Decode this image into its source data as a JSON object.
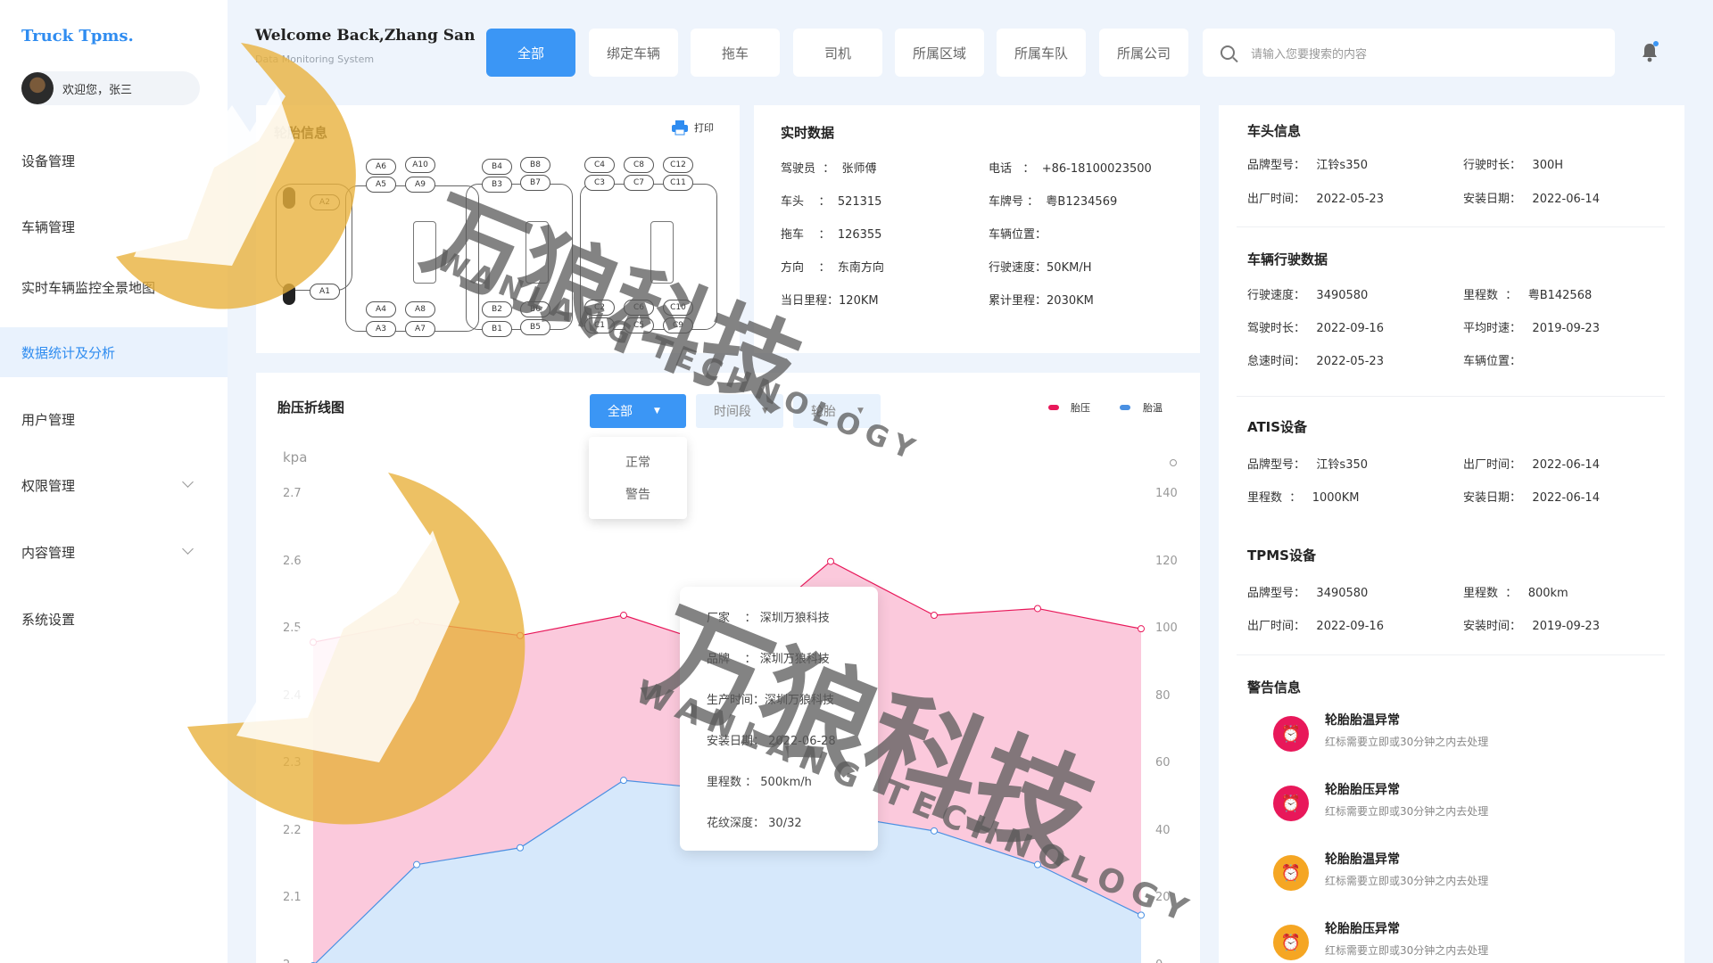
{
  "app": {
    "logo": "Truck Tpms.",
    "welcome": "Welcome Back,Zhang San",
    "subtitle": "Data Monitoring System",
    "user_greeting": "欢迎您，张三"
  },
  "sidebar": {
    "items": [
      {
        "label": "设备管理"
      },
      {
        "label": "车辆管理"
      },
      {
        "label": "实时车辆监控全景地图"
      },
      {
        "label": "数据统计及分析",
        "active": true
      },
      {
        "label": "用户管理"
      },
      {
        "label": "权限管理",
        "expandable": true
      },
      {
        "label": "内容管理",
        "expandable": true
      },
      {
        "label": "系统设置"
      }
    ]
  },
  "tabs": [
    "全部",
    "绑定车辆",
    "拖车",
    "司机",
    "所属区域",
    "所属车队",
    "所属公司"
  ],
  "search": {
    "placeholder": "请输入您要搜索的内容"
  },
  "tire_card": {
    "title": "轮胎信息",
    "print": "打印",
    "tires": [
      "A6",
      "A10",
      "A5",
      "A9",
      "A2",
      "A1",
      "A4",
      "A8",
      "A3",
      "A7",
      "B4",
      "B8",
      "B3",
      "B7",
      "B2",
      "B6",
      "B1",
      "B5",
      "C4",
      "C8",
      "C12",
      "C3",
      "C7",
      "C11",
      "C2",
      "C6",
      "C10",
      "C1",
      "C5",
      "C9"
    ]
  },
  "realtime": {
    "title": "实时数据",
    "fields": [
      {
        "k": "驾驶员",
        "v": "张师傅"
      },
      {
        "k": "电话",
        "v": "+86-18100023500"
      },
      {
        "k": "车头",
        "v": "521315"
      },
      {
        "k": "车牌号",
        "v": "粤B1234569"
      },
      {
        "k": "拖车",
        "v": "126355"
      },
      {
        "k": "车辆位置",
        "v": ""
      },
      {
        "k": "方向",
        "v": "东南方向"
      },
      {
        "k": "行驶速度",
        "v": "50KM/H"
      },
      {
        "k": "当日里程",
        "v": "120KM"
      },
      {
        "k": "累计里程",
        "v": "2030KM"
      }
    ]
  },
  "right_panel": {
    "head": {
      "title": "车头信息",
      "fields": [
        {
          "k": "品牌型号",
          "v": "江铃s350"
        },
        {
          "k": "行驶时长",
          "v": "300H"
        },
        {
          "k": "出厂时间",
          "v": "2022-05-23"
        },
        {
          "k": "安装日期",
          "v": "2022-06-14"
        }
      ]
    },
    "driving": {
      "title": "车辆行驶数据",
      "fields": [
        {
          "k": "行驶速度",
          "v": "3490580"
        },
        {
          "k": "里程数",
          "v": "粤B142568"
        },
        {
          "k": "驾驶时长",
          "v": "2022-09-16"
        },
        {
          "k": "平均时速",
          "v": "2019-09-23"
        },
        {
          "k": "怠速时间",
          "v": "2022-05-23"
        },
        {
          "k": "车辆位置",
          "v": ""
        }
      ]
    },
    "atis": {
      "title": "ATIS设备",
      "fields": [
        {
          "k": "品牌型号",
          "v": "江铃s350"
        },
        {
          "k": "出厂时间",
          "v": "2022-06-14"
        },
        {
          "k": "里程数",
          "v": "1000KM"
        },
        {
          "k": "安装日期",
          "v": "2022-06-14"
        }
      ]
    },
    "tpms": {
      "title": "TPMS设备",
      "fields": [
        {
          "k": "品牌型号",
          "v": "3490580"
        },
        {
          "k": "里程数",
          "v": "800km"
        },
        {
          "k": "出厂时间",
          "v": "2022-09-16"
        },
        {
          "k": "安装时间",
          "v": "2019-09-23"
        }
      ]
    },
    "alerts": {
      "title": "警告信息",
      "items": [
        {
          "title": "轮胎胎温异常",
          "desc": "红标需要立即或30分钟之内去处理",
          "color": "#e8185a"
        },
        {
          "title": "轮胎胎压异常",
          "desc": "红标需要立即或30分钟之内去处理",
          "color": "#e8185a"
        },
        {
          "title": "轮胎胎温异常",
          "desc": "红标需要立即或30分钟之内去处理",
          "color": "#f5a623"
        },
        {
          "title": "轮胎胎压异常",
          "desc": "红标需要立即或30分钟之内去处理",
          "color": "#f5a623"
        }
      ]
    }
  },
  "chart_card": {
    "title": "胎压折线图",
    "filters": {
      "status": "全部",
      "time": "时间段",
      "tire": "轮胎",
      "options": [
        "正常",
        "警告"
      ]
    },
    "tooltip": [
      {
        "k": "厂家",
        "v": "深圳万狼科技"
      },
      {
        "k": "品牌",
        "v": "深圳万狼科技"
      },
      {
        "k": "生产时间",
        "v": "深圳万狼科技"
      },
      {
        "k": "安装日期",
        "v": "2022-06-28"
      },
      {
        "k": "里程数",
        "v": "500km/h"
      },
      {
        "k": "花纹深度",
        "v": "30/32"
      }
    ]
  },
  "chart_data": {
    "type": "area",
    "ylabel": "kpa",
    "legend": [
      "胎压",
      "胎温"
    ],
    "y_left": {
      "ticks": [
        "2.7",
        "2.6",
        "2.5",
        "2.4",
        "2.3",
        "2.2",
        "2.1",
        "2"
      ],
      "range": [
        2.0,
        2.7
      ]
    },
    "y_right": {
      "ticks": [
        "140",
        "120",
        "100",
        "80",
        "60",
        "40",
        "20",
        "0"
      ],
      "range": [
        0,
        140
      ]
    },
    "series": [
      {
        "name": "胎压",
        "color": "#e8185a",
        "values": [
          2.48,
          2.51,
          2.49,
          2.52,
          2.47,
          2.6,
          2.52,
          2.53,
          2.5
        ]
      },
      {
        "name": "胎温",
        "color": "#4a90e2",
        "values": [
          0,
          30,
          35,
          55,
          52,
          45,
          40,
          30,
          15
        ]
      }
    ],
    "series_axis": [
      "left",
      "right"
    ]
  },
  "watermark": {
    "cn": "万狼科技",
    "en": "WANLANG TECHNOLOGY"
  },
  "colors": {
    "accent": "#3b96f5",
    "pressure": "#e8185a",
    "temp": "#4a90e2"
  }
}
